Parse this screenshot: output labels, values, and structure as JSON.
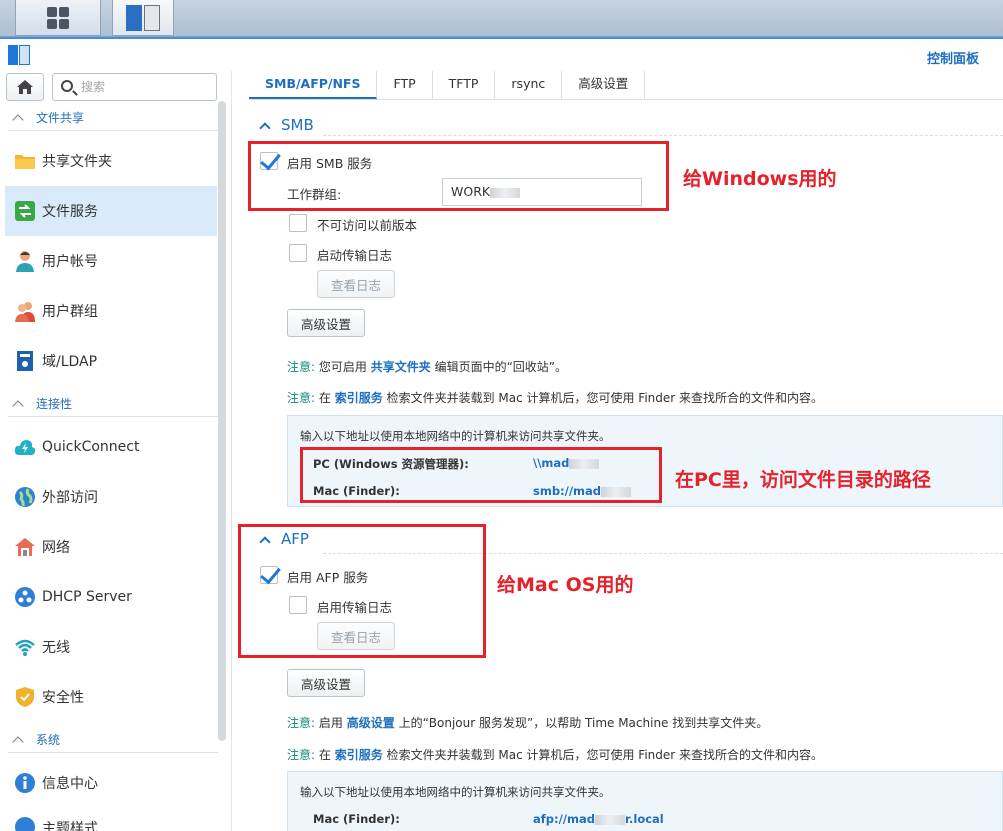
{
  "window": {
    "title": "控制面板"
  },
  "taskbar": {
    "buttons": [
      "main-menu",
      "control-panel"
    ]
  },
  "sidebar": {
    "search_placeholder": "搜索",
    "sections": [
      {
        "label": "文件共享"
      },
      {
        "label": "连接性"
      },
      {
        "label": "系统"
      }
    ],
    "items": [
      {
        "label": "共享文件夹",
        "icon": "folder-icon"
      },
      {
        "label": "文件服务",
        "icon": "file-services-icon"
      },
      {
        "label": "用户帐号",
        "icon": "user-icon"
      },
      {
        "label": "用户群组",
        "icon": "group-icon"
      },
      {
        "label": "域/LDAP",
        "icon": "domain-icon"
      },
      {
        "label": "QuickConnect",
        "icon": "cloud-icon"
      },
      {
        "label": "外部访问",
        "icon": "globe-icon"
      },
      {
        "label": "网络",
        "icon": "network-icon"
      },
      {
        "label": "DHCP Server",
        "icon": "dhcp-icon"
      },
      {
        "label": "无线",
        "icon": "wifi-icon"
      },
      {
        "label": "安全性",
        "icon": "shield-icon"
      },
      {
        "label": "信息中心",
        "icon": "info-icon"
      },
      {
        "label": "主题样式",
        "icon": "theme-icon"
      }
    ]
  },
  "tabs": [
    "SMB/AFP/NFS",
    "FTP",
    "TFTP",
    "rsync",
    "高级设置"
  ],
  "smb": {
    "title": "SMB",
    "enable_label": "启用 SMB 服务",
    "workgroup_label": "工作群组:",
    "workgroup_value": "WORK",
    "prev_versions_label": "不可访问以前版本",
    "transfer_log_label": "启动传输日志",
    "view_log_button": "查看日志",
    "advanced_button": "高级设置",
    "note1": {
      "prefix": "注意:",
      "pre": "您可启用",
      "link": "共享文件夹",
      "post": "编辑页面中的“回收站”。"
    },
    "note2": {
      "prefix": "注意:",
      "pre": "在",
      "link": "索引服务",
      "post": "检索文件夹并装载到 Mac 计算机后，您可使用 Finder 来查找所合的文件和内容。"
    },
    "info": {
      "desc": "输入以下地址以使用本地网络中的计算机来访问共享文件夹。",
      "pc_label": "PC (Windows 资源管理器):",
      "pc_value": "\\\\mad",
      "mac_label": "Mac (Finder):",
      "mac_value": "smb://mad"
    }
  },
  "afp": {
    "title": "AFP",
    "enable_label": "启用 AFP 服务",
    "transfer_log_label": "启用传输日志",
    "view_log_button": "查看日志",
    "advanced_button": "高级设置",
    "note1": {
      "prefix": "注意:",
      "pre": "启用",
      "link": "高级设置",
      "post": "上的“Bonjour 服务发现”，以帮助 Time Machine 找到共享文件夹。"
    },
    "note2": {
      "prefix": "注意:",
      "pre": "在",
      "link": "索引服务",
      "post": "检索文件夹并装载到 Mac 计算机后，您可使用 Finder 来查找所合的文件和内容。"
    },
    "info": {
      "desc": "输入以下地址以使用本地网络中的计算机来访问共享文件夹。",
      "mac_label": "Mac (Finder):",
      "mac_value_pre": "afp://mad",
      "mac_value_post": "r.local"
    }
  },
  "annotations": {
    "smb_note": "给Windows用的",
    "path_note": "在PC里，访问文件目录的路径",
    "afp_note": "给Mac OS用的"
  },
  "colors": {
    "accent": "#1e6fbf",
    "annotation": "#e5222b",
    "active_nav": "#d9eafa"
  }
}
